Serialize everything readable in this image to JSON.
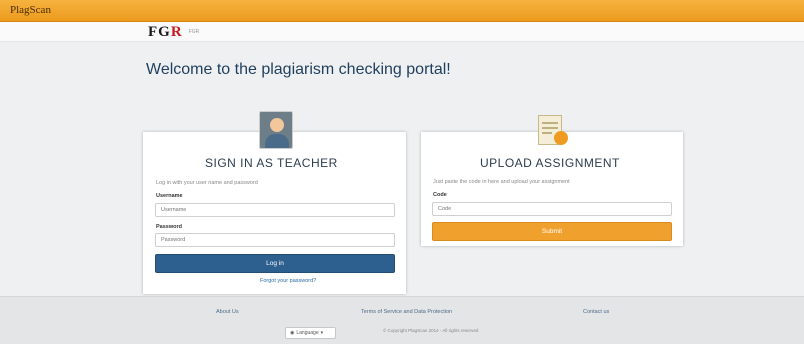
{
  "topbar": {
    "brand": "PlagScan"
  },
  "header": {
    "logo_main": "FG",
    "logo_accent": "R",
    "logo_sub": "FGR"
  },
  "main": {
    "welcome": "Welcome to the plagiarism checking portal!"
  },
  "teacher": {
    "title": "SIGN IN AS TEACHER",
    "hint": "Log in with your user name and password",
    "username_label": "Username",
    "username_placeholder": "Username",
    "password_label": "Password",
    "password_placeholder": "Password",
    "login_button": "Log in",
    "forgot_link": "Forgot your password?"
  },
  "upload": {
    "title": "UPLOAD ASSIGNMENT",
    "hint": "Just paste the code in here and upload your assignment",
    "code_label": "Code",
    "code_placeholder": "Code",
    "submit_button": "Submit"
  },
  "footer": {
    "about": "About Us",
    "terms": "Terms of Service and Data Protection",
    "contact": "Contact us",
    "language": "Language",
    "copyright": "© Copyright PlagScan 2014 - All rights reserved"
  },
  "colors": {
    "accent": "#ef9b22",
    "primary": "#2d5f8f"
  }
}
